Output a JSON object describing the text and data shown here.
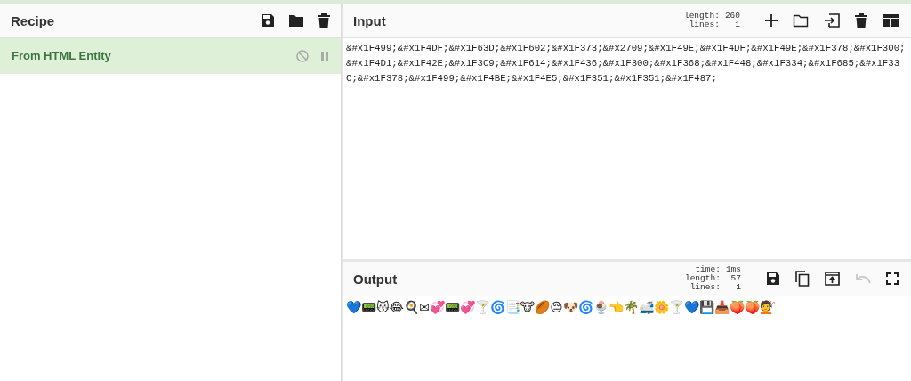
{
  "recipe": {
    "title": "Recipe",
    "operations": [
      {
        "name": "From HTML Entity",
        "disabled": false,
        "breakpoint": false
      }
    ]
  },
  "input": {
    "title": "Input",
    "stats": [
      {
        "label": "length:",
        "value": "260"
      },
      {
        "label": "lines:",
        "value": "1"
      }
    ],
    "text": "&#x1F499;&#x1F4DF;&#x1F63D;&#x1F602;&#x1F373;&#x2709;&#x1F49E;&#x1F4DF;&#x1F49E;&#x1F378;&#x1F300;&#x1F4D1;&#x1F42E;&#x1F3C9;&#x1F614;&#x1F436;&#x1F300;&#x1F368;&#x1F448;&#x1F334;&#x1F685;&#x1F33C;&#x1F378;&#x1F499;&#x1F4BE;&#x1F4E5;&#x1F351;&#x1F351;&#x1F487;"
  },
  "output": {
    "title": "Output",
    "stats": [
      {
        "label": "time:",
        "value": "1ms"
      },
      {
        "label": "length:",
        "value": "57"
      },
      {
        "label": "lines:",
        "value": "1"
      }
    ],
    "text": "💙📟😽😂🍳✉💞📟💞🍸🌀📑🐮🏉😔🐶🌀🍨👈🌴🚅🌼🍸💙💾📥🍑🍑💇",
    "undo_disabled": true
  }
}
